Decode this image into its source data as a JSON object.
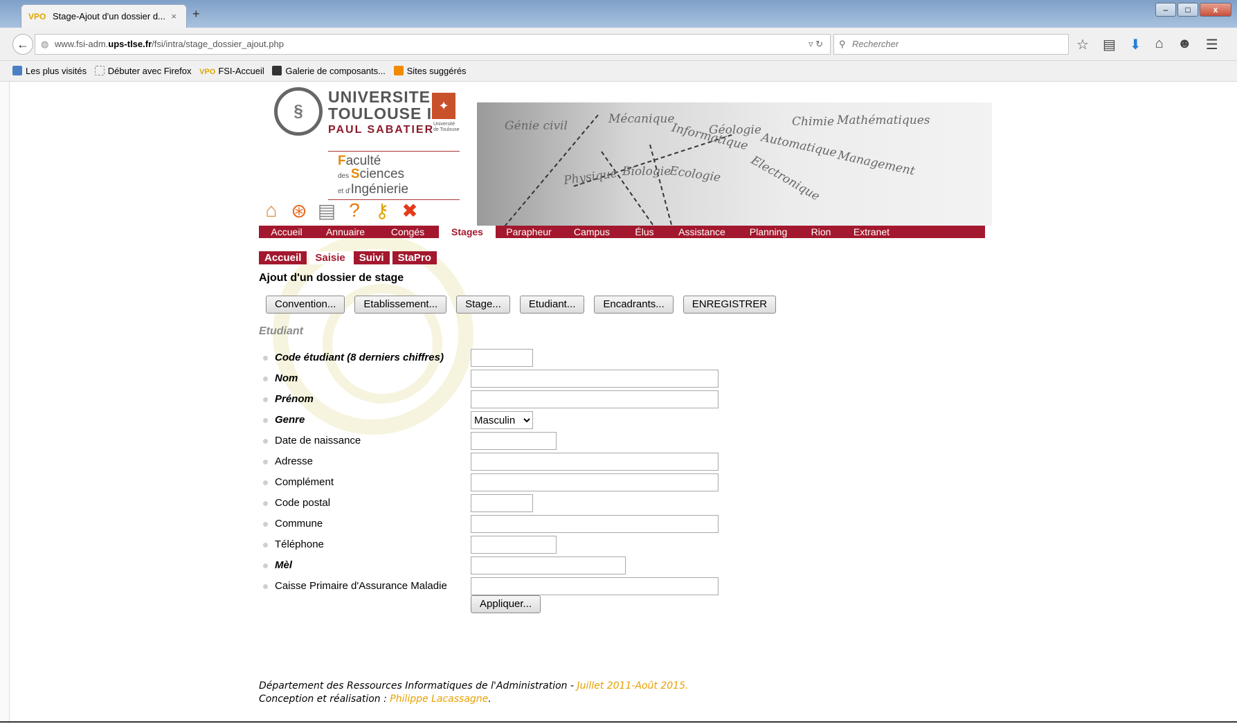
{
  "browser": {
    "tab_title": "Stage-Ajout d'un dossier d...",
    "tab_close": "×",
    "new_tab": "+",
    "url_prefix": "www.fsi-adm.",
    "url_domain": "ups-tlse.fr",
    "url_path": "/fsi/intra/stage_dossier_ajout.php",
    "search_placeholder": "Rechercher",
    "window_buttons": [
      "–",
      "□",
      "x"
    ],
    "bookmarks": [
      "Les plus visités",
      "Débuter avec Firefox",
      "FSI-Accueil",
      "Galerie de composants...",
      "Sites suggérés"
    ]
  },
  "logo": {
    "line1": "UNIVERSITE",
    "line2": "TOULOUSE III",
    "line3": "PAUL SABATIER",
    "small": "Université de Toulouse",
    "fac_line1_cap": "F",
    "fac_line1": "aculté",
    "fac_line2_pre": "des ",
    "fac_line2_cap": "S",
    "fac_line2": "ciences",
    "fac_line3_pre": "et d'",
    "fac_line3": "Ingénierie"
  },
  "banner_words": [
    "Génie civil",
    "Mécanique",
    "Informatique",
    "Géologie",
    "Automatique",
    "Management",
    "Chimie",
    "Mathématiques",
    "Physique",
    "Biologie",
    "Ecologie",
    "Electronique"
  ],
  "main_menu": [
    {
      "label": "Accueil",
      "active": false
    },
    {
      "label": "Annuaire",
      "active": false
    },
    {
      "label": "Congés",
      "active": false
    },
    {
      "label": "Stages",
      "active": true
    },
    {
      "label": "Parapheur",
      "active": false
    },
    {
      "label": "Campus",
      "active": false
    },
    {
      "label": "Élus",
      "active": false
    },
    {
      "label": "Assistance",
      "active": false
    },
    {
      "label": "Planning",
      "active": false
    },
    {
      "label": "Rion",
      "active": false
    },
    {
      "label": "Extranet",
      "active": false
    }
  ],
  "sub_menu": [
    {
      "label": "Accueil",
      "active": false
    },
    {
      "label": "Saisie",
      "active": true
    },
    {
      "label": "Suivi",
      "active": false
    },
    {
      "label": "StaPro",
      "active": false
    }
  ],
  "page_title": "Ajout d'un dossier de stage",
  "buttons": [
    "Convention...",
    "Etablissement...",
    "Stage...",
    "Etudiant...",
    "Encadrants...",
    "ENREGISTRER"
  ],
  "section_title": "Etudiant",
  "form": {
    "code_label": "Code étudiant (8 derniers chiffres)",
    "nom_label": "Nom",
    "prenom_label": "Prénom",
    "genre_label": "Genre",
    "genre_value": "Masculin",
    "naissance_label": "Date de naissance",
    "adresse_label": "Adresse",
    "complement_label": "Complément",
    "cp_label": "Code postal",
    "commune_label": "Commune",
    "tel_label": "Téléphone",
    "mel_label": "Mèl",
    "cpam_label": "Caisse Primaire d'Assurance Maladie",
    "apply_label": "Appliquer..."
  },
  "footer": {
    "line1": "Département des Ressources Informatiques de l'Administration - ",
    "line1_date": "Juillet 2011-Août 2015.",
    "line2": "Conception et réalisation : ",
    "line2_author": "Philippe Lacassagne",
    "line2_end": "."
  },
  "colors": {
    "brand": "#a3182e",
    "accent": "#e9a000"
  }
}
